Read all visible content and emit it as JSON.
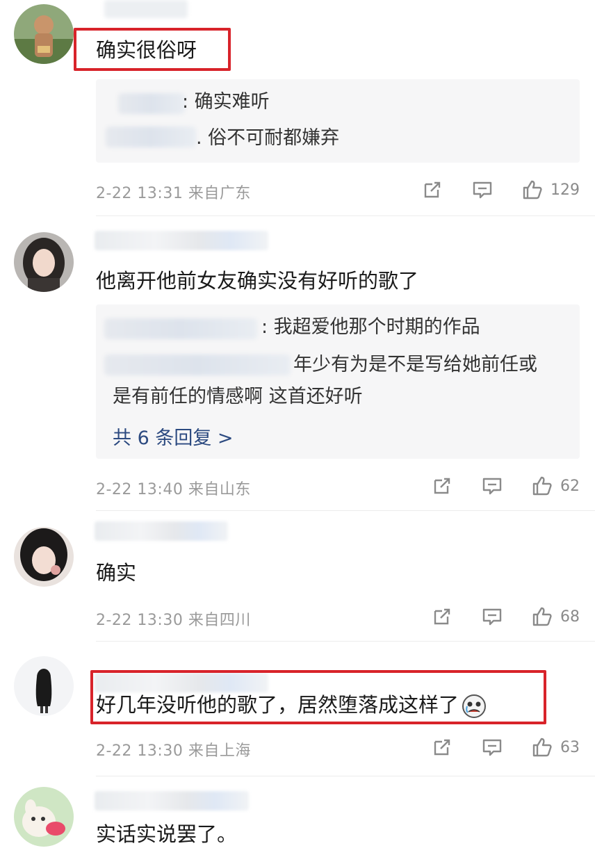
{
  "comments": [
    {
      "text": "确实很俗呀",
      "replies": [
        {
          "text": ": 确实难听"
        },
        {
          "text": ". 俗不可耐都嫌弃"
        }
      ],
      "time": "2-22 13:31",
      "location": "来自广东",
      "likes": "129"
    },
    {
      "text": "他离开他前女友确实没有好听的歌了",
      "replies": [
        {
          "text": ": 我超爱他那个时期的作品"
        },
        {
          "text": "年少有为是不是写给她前任或"
        },
        {
          "text": "是有前任的情感啊 这首还好听"
        }
      ],
      "more": "共 6 条回复 >",
      "time": "2-22 13:40",
      "location": "来自山东",
      "likes": "62"
    },
    {
      "text": "确实",
      "time": "2-22 13:30",
      "location": "来自四川",
      "likes": "68"
    },
    {
      "text": "好几年没听他的歌了，居然堕落成这样了",
      "time": "2-22 13:30",
      "location": "来自上海",
      "likes": "63"
    },
    {
      "text": "实话实说罢了。"
    }
  ],
  "colors": {
    "highlight": "#d8232a",
    "link": "#2c4a80",
    "meta": "#9a9a9a"
  }
}
